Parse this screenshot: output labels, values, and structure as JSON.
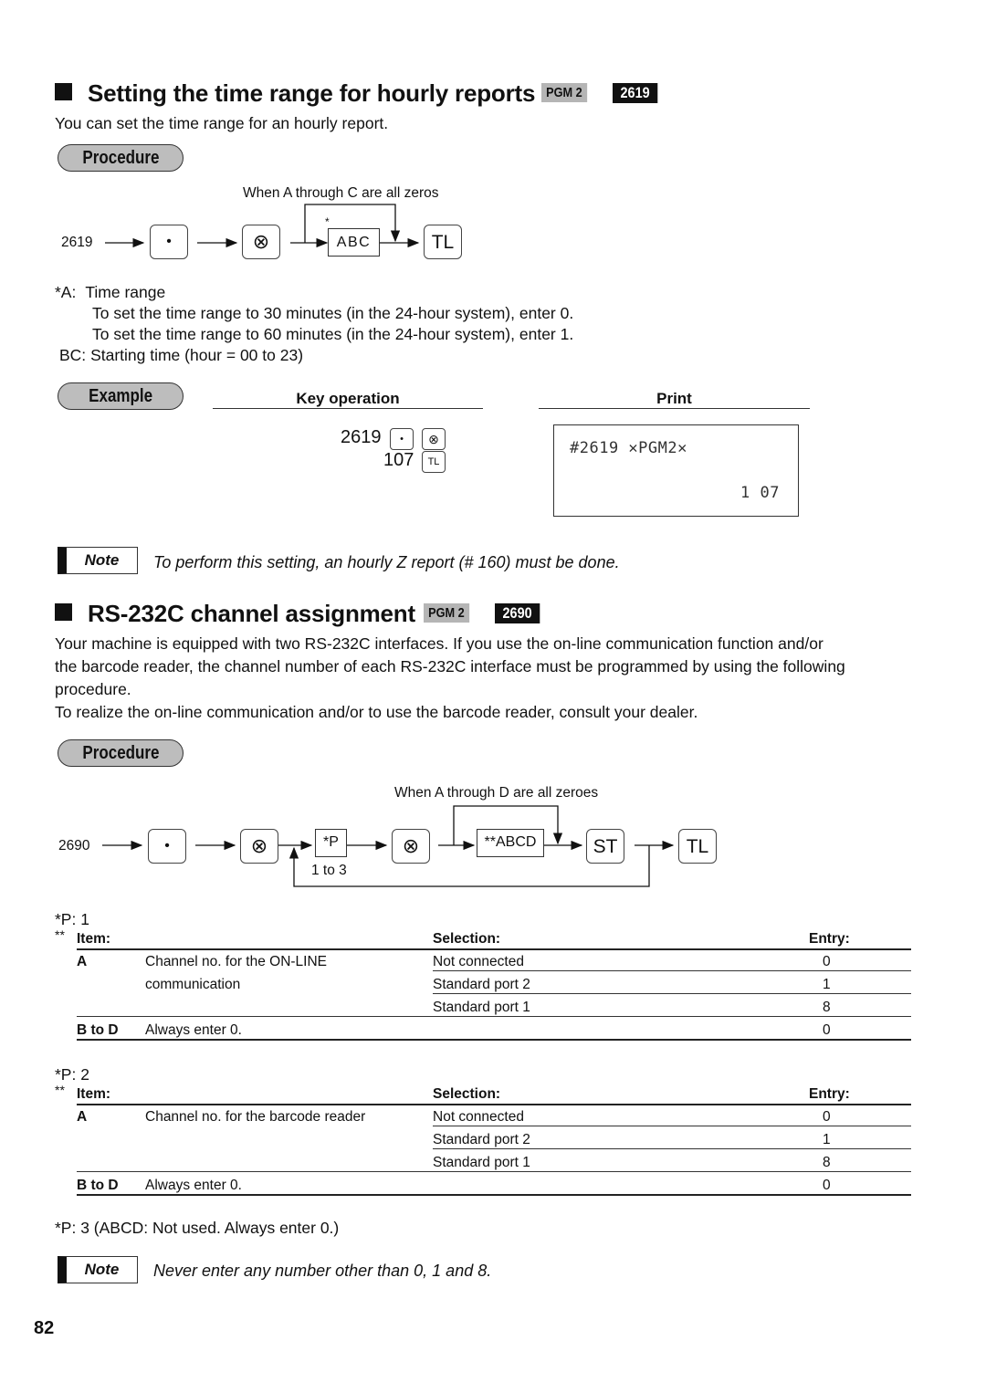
{
  "section1": {
    "title": "Setting the time range for hourly reports",
    "pgm_tag": "PGM 2",
    "code_tag": "2619",
    "intro": "You can set the time range for an hourly report.",
    "procedure_label": "Procedure",
    "diagram": {
      "start": "2619",
      "key_dot": "•",
      "key_multiply": "⊗",
      "bypass_label": "When A through C are all zeros",
      "asterisk": "*",
      "box_abc": "ABC",
      "key_tl": "TL"
    },
    "notes": [
      {
        "prefix": "*A:",
        "text": "Time range"
      },
      {
        "prefix": "",
        "text": "To set the time range to 30 minutes (in the 24-hour system), enter 0."
      },
      {
        "prefix": "",
        "text": "To set the time range to 60 minutes (in the 24-hour system), enter 1."
      },
      {
        "prefix": "BC:",
        "text": "Starting time (hour = 00 to 23)"
      }
    ],
    "example_label": "Example",
    "key_operation_header": "Key operation",
    "print_header": "Print",
    "key_operation": {
      "line1_value": "2619",
      "line1_key1": "•",
      "line1_key2": "⊗",
      "line2_value": "107",
      "line2_key": "TL"
    },
    "print": {
      "line1": "#2619 ✕PGM2✕",
      "line2": "1 07"
    },
    "note_label": "Note",
    "note_text": "To perform this setting, an hourly Z report (# 160) must be done."
  },
  "section2": {
    "title": "RS-232C channel assignment",
    "pgm_tag": "PGM 2",
    "code_tag": "2690",
    "intro_lines": [
      "Your machine is equipped with two RS-232C interfaces. If you use the on-line communication function and/or",
      "the barcode reader, the channel number of each RS-232C interface must be programmed by using the following",
      "procedure.",
      "To realize the on-line communication and/or to use the barcode reader, consult your dealer."
    ],
    "procedure_label": "Procedure",
    "diagram": {
      "start": "2690",
      "key_dot": "•",
      "key_multiply": "⊗",
      "box_p": "*P",
      "p_range": "1 to 3",
      "bypass_label": "When A through D are all zeroes",
      "box_abcd": "**ABCD",
      "key_st": "ST",
      "key_tl": "TL"
    },
    "tables": [
      {
        "label": "*P: 1",
        "marker": "**",
        "headers": {
          "item": "Item:",
          "selection": "Selection:",
          "entry": "Entry:"
        },
        "rows": [
          {
            "code": "A",
            "desc": "Channel no. for the ON-LINE",
            "selection": "Not connected",
            "entry": "0"
          },
          {
            "code": "",
            "desc": "communication",
            "selection": "Standard port 2",
            "entry": "1"
          },
          {
            "code": "",
            "desc": "",
            "selection": "Standard port 1",
            "entry": "8"
          },
          {
            "code": "B to D",
            "desc": "Always enter 0.",
            "selection": "",
            "entry": "0"
          }
        ]
      },
      {
        "label": "*P: 2",
        "marker": "**",
        "headers": {
          "item": "Item:",
          "selection": "Selection:",
          "entry": "Entry:"
        },
        "rows": [
          {
            "code": "A",
            "desc": "Channel no. for the barcode reader",
            "selection": "Not connected",
            "entry": "0"
          },
          {
            "code": "",
            "desc": "",
            "selection": "Standard port 2",
            "entry": "1"
          },
          {
            "code": "",
            "desc": "",
            "selection": "Standard port 1",
            "entry": "8"
          },
          {
            "code": "B to D",
            "desc": "Always enter 0.",
            "selection": "",
            "entry": "0"
          }
        ]
      }
    ],
    "p3_text": "*P: 3 (ABCD: Not used. Always enter 0.)",
    "note_label": "Note",
    "note_text": "Never enter any number other than 0, 1 and 8."
  },
  "page_number": "82"
}
